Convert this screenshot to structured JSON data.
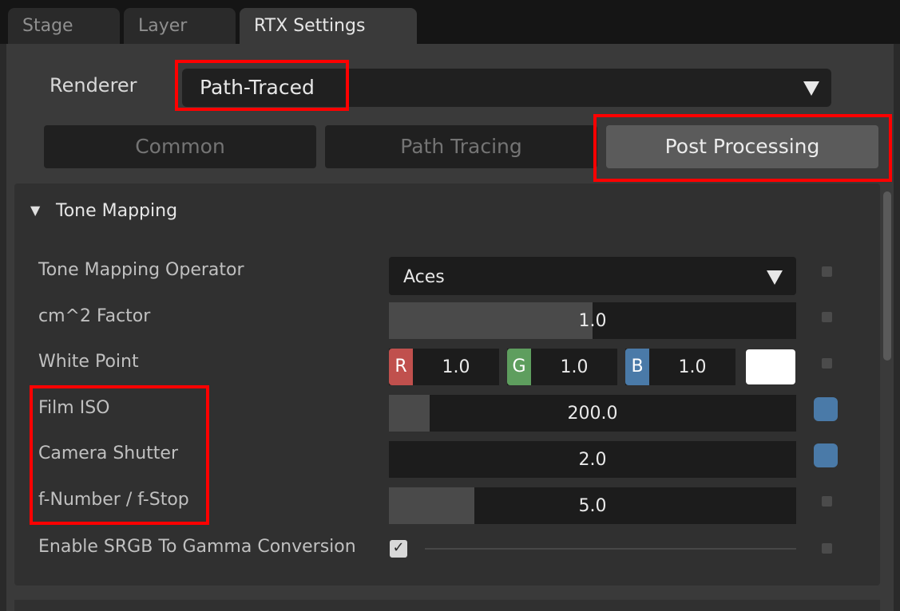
{
  "tabs": [
    "Stage",
    "Layer",
    "RTX Settings"
  ],
  "renderer": {
    "label": "Renderer",
    "value": "Path-Traced"
  },
  "mode_buttons": [
    "Common",
    "Path Tracing",
    "Post Processing"
  ],
  "section": {
    "title": "Tone Mapping"
  },
  "tone_mapping_operator": {
    "label": "Tone Mapping Operator",
    "value": "Aces"
  },
  "cm2_factor": {
    "label": "cm^2 Factor",
    "value": "1.0",
    "fill_fraction": 0.5
  },
  "white_point": {
    "label": "White Point",
    "r_label": "R",
    "r": "1.0",
    "g_label": "G",
    "g": "1.0",
    "b_label": "B",
    "b": "1.0",
    "swatch": "#ffffff"
  },
  "film_iso": {
    "label": "Film ISO",
    "value": "200.0",
    "fill_fraction": 0.1
  },
  "camera_shutter": {
    "label": "Camera Shutter",
    "value": "2.0"
  },
  "f_number": {
    "label": "f-Number / f-Stop",
    "value": "5.0",
    "fill_fraction": 0.21
  },
  "srgb": {
    "label": "Enable SRGB To Gamma Conversion",
    "checked": true
  },
  "colors": {
    "highlight": "#ff0000",
    "modified_indicator": "#4a7aa8",
    "r": "#c0504d",
    "g": "#5e9e5e",
    "b": "#4a7aa8"
  }
}
